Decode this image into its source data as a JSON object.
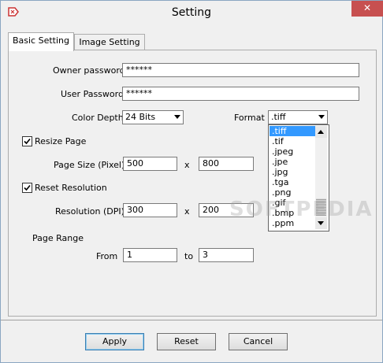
{
  "window": {
    "title": "Setting",
    "close_label": "✕"
  },
  "tabs": [
    {
      "label": "Basic Setting",
      "active": true
    },
    {
      "label": "Image Setting",
      "active": false
    }
  ],
  "owner_password": {
    "label": "Owner password",
    "value": "******"
  },
  "user_password": {
    "label": "User Password",
    "value": "******"
  },
  "color_depth": {
    "label": "Color Depth",
    "value": "24 Bits"
  },
  "format": {
    "label": "Format",
    "value": ".tiff",
    "options": [
      ".tiff",
      ".tif",
      ".jpeg",
      ".jpe",
      ".jpg",
      ".tga",
      ".png",
      ".gif",
      ".bmp",
      ".ppm"
    ],
    "selected_index": 0
  },
  "resize_page": {
    "label": "Resize Page",
    "checked": true
  },
  "page_size": {
    "label": "Page Size (Pixel)",
    "width": "500",
    "separator": "x",
    "height": "800"
  },
  "reset_resolution": {
    "label": "Reset Resolution",
    "checked": true
  },
  "resolution": {
    "label": "Resolution (DPI)",
    "x": "300",
    "separator": "x",
    "y": "200"
  },
  "page_range": {
    "label": "Page Range",
    "from_label": "From",
    "from": "1",
    "to_label": "to",
    "to": "3"
  },
  "buttons": {
    "apply": "Apply",
    "reset": "Reset",
    "cancel": "Cancel"
  },
  "watermark": "SOFTPEDIA",
  "colors": {
    "selection": "#3399ff",
    "close": "#c75050",
    "frame": "#8aa6c1"
  }
}
